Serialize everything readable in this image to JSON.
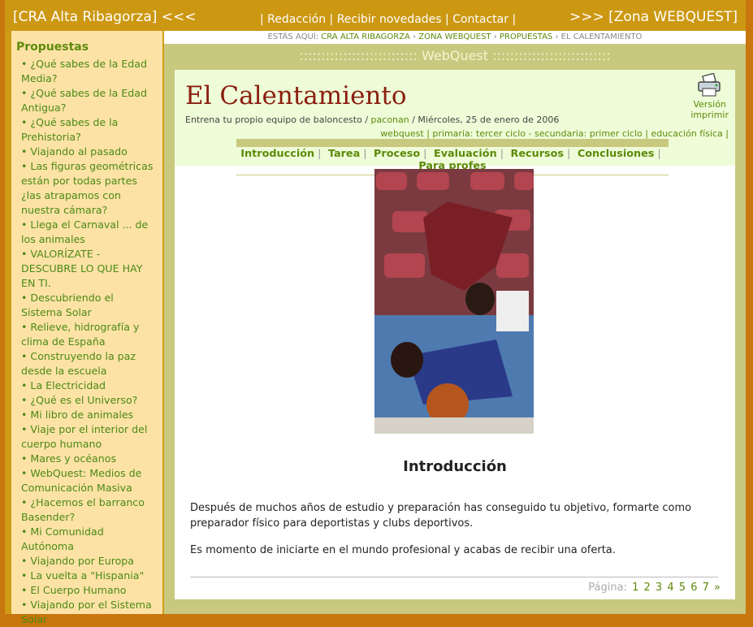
{
  "topbar": {
    "left": "[CRA Alta Ribagorza] <<<",
    "nav": [
      "| Redacción",
      "| Recibir novedades",
      "| Contactar |"
    ],
    "right": ">>> [Zona WEBQUEST]"
  },
  "sidebar": {
    "title": "Propuestas",
    "items": [
      "• ¿Qué sabes de la Edad Media?",
      "• ¿Qué sabes de la Edad Antigua?",
      "• ¿Qué sabes de la Prehistoria?",
      "• Viajando al pasado",
      "• Las figuras geométricas están por todas partes ¿las atrapamos con nuestra cámara?",
      "• Llega el Carnaval ... de los animales",
      "• VALORÍZATE - DESCUBRE LO QUE HAY EN TI.",
      "• Descubriendo el Sistema Solar",
      "• Relieve, hidrografía y clima de España",
      "• Construyendo la paz desde la escuela",
      "• La Electricidad",
      "• ¿Qué es el Universo?",
      "• Mi libro de animales",
      "• Viaje por el interior del cuerpo humano",
      "• Mares y océanos",
      "• WebQuest: Medios de Comunicación Masiva",
      "• ¿Hacemos el barranco Basender?",
      "• Mi Comunidad Autónoma",
      "• Viajando por Europa",
      "• La vuelta a \"Hispania\"",
      "• El Cuerpo Humano",
      "• Viajando por el Sistema Solar"
    ]
  },
  "breadcrumb": {
    "prefix": "ESTÁS AQUÍ:",
    "links": [
      "CRA ALTA RIBAGORZA",
      "ZONA WEBQUEST",
      "PROPUESTAS"
    ],
    "current": "EL CALENTAMIENTO"
  },
  "band": {
    "label": "::::::::::::::::::::::::::: WebQuest :::::::::::::::::::::::::::"
  },
  "article": {
    "title": "El Calentamiento",
    "subtitle_text": "Entrena tu propio equipo de baloncesto /",
    "author": "paconan",
    "date": "/ Miércoles, 25 de enero de 2006",
    "print_line1": "Versión",
    "print_line2": "imprimir",
    "tags": "webquest | primaria: tercer ciclo - secundaria: primer ciclo | educación física |",
    "tabs": [
      "Introducción",
      "Tarea",
      "Proceso",
      "Evaluación",
      "Recursos",
      "Conclusiones",
      "Para profes"
    ],
    "section": "Introducción",
    "para1": "Después de muchos años de estudio y preparación has conseguido tu objetivo, formarte como preparador físico para deportistas y clubs deportivos.",
    "para2": "Es momento de iniciarte en el mundo profesional y acabas de recibir una oferta.",
    "pager_label": "Página:",
    "pages": [
      "1",
      "2",
      "3",
      "4",
      "5",
      "6",
      "7",
      "»"
    ]
  }
}
